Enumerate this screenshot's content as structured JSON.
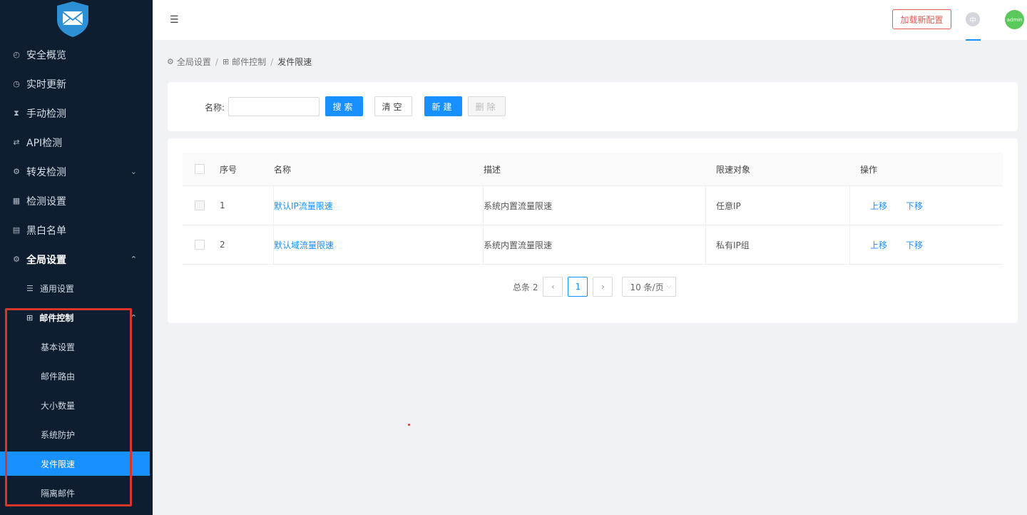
{
  "sidebar": {
    "logo_icon": "mail-shield-icon",
    "menu": [
      {
        "label": "安全概览",
        "icon": "dashboard-icon"
      },
      {
        "label": "实时更新",
        "icon": "clock-icon"
      },
      {
        "label": "手动检测",
        "icon": "hourglass-icon"
      },
      {
        "label": "API检测",
        "icon": "api-icon"
      },
      {
        "label": "转发检测",
        "icon": "gear-icon"
      },
      {
        "label": "检测设置",
        "icon": "grid-icon"
      },
      {
        "label": "黑白名单",
        "icon": "list-icon"
      },
      {
        "label": "全局设置",
        "icon": "gear-icon"
      }
    ],
    "sub_menu": [
      {
        "label": "通用设置",
        "icon": "menu-lines-icon"
      },
      {
        "label": "邮件控制",
        "icon": "apps-icon"
      }
    ],
    "sub2_menu": [
      {
        "label": "基本设置"
      },
      {
        "label": "邮件路由"
      },
      {
        "label": "大小数量"
      },
      {
        "label": "系统防护"
      },
      {
        "label": "发件限速",
        "active": true
      },
      {
        "label": "隔离邮件"
      }
    ]
  },
  "header": {
    "reload_label": "加载新配置",
    "lang_label": "中",
    "avatar_label": "admin"
  },
  "breadcrumb": [
    "全局设置",
    "邮件控制",
    "发件限速"
  ],
  "search": {
    "name_label": "名称:",
    "name_value": "",
    "search_label": "搜索",
    "clear_label": "清空",
    "new_label": "新建",
    "delete_label": "删除"
  },
  "table": {
    "headers": [
      "序号",
      "名称",
      "描述",
      "限速对象",
      "操作"
    ],
    "rows": [
      {
        "idx": "1",
        "name": "默认IP流量限速",
        "desc": "系统内置流量限速",
        "target": "任意IP",
        "up": "上移",
        "down": "下移"
      },
      {
        "idx": "2",
        "name": "默认域流量限速",
        "desc": "系统内置流量限速",
        "target": "私有IP组",
        "up": "上移",
        "down": "下移"
      }
    ]
  },
  "pagination": {
    "total_label": "总条 2",
    "current_page": "1",
    "page_size_label": "10 条/页"
  },
  "colors": {
    "sidebar_bg": "#0e1d2f",
    "primary": "#1890ff",
    "danger": "#e25c55",
    "annotation_red": "#d9362b"
  }
}
